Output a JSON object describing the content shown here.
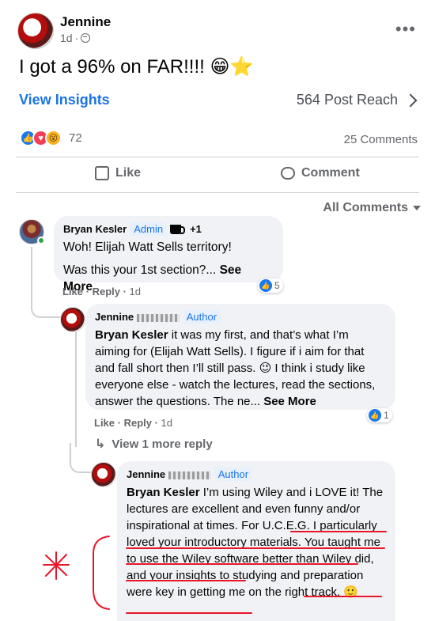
{
  "post": {
    "author": "Jennine",
    "time": "1d",
    "text": "I got a 96% on FAR!!!! 😁⭐",
    "insights_label": "View Insights",
    "reach_label": "564 Post Reach",
    "reaction_count": "72",
    "comments_count": "25 Comments",
    "like_label": "Like",
    "comment_label": "Comment",
    "all_comments_label": "All Comments"
  },
  "comments": [
    {
      "author": "Bryan Kesler",
      "badge": "Admin",
      "extra": "+1",
      "line1": "Woh! Elijah Watt Sells territory!",
      "line2": "Was this your 1st section?...",
      "see_more": "See More",
      "like": "Like",
      "reply": "Reply",
      "time": "1d",
      "reactions": "5"
    },
    {
      "author": "Jennine",
      "badge": "Author",
      "mention": "Bryan Kesler",
      "text": " it was my first, and that’s what I’m aiming for (Elijah Watt Sells). I figure if i aim for that and fall short then I’ll still pass. 😉 I think i study like everyone else - watch the lectures, read the sections, answer the questions. The ne...",
      "see_more": "See More",
      "like": "Like",
      "reply": "Reply",
      "time": "1d",
      "reactions": "1"
    },
    {
      "author": "Jennine",
      "badge": "Author",
      "mention": "Bryan Kesler",
      "text": " I’m using Wiley and i LOVE it! The lectures are excellent and even funny and/or inspirational at times. For U.C.E.G. I particularly loved your introductory materials. You taught me to use the Wiley software better than Wiley did, and your insights to studying and preparation were key in getting me on the right track. 🙂"
    }
  ],
  "view_more_reply": "View 1 more reply",
  "colors": {
    "accent": "#1b74e4",
    "annotation": "#e8162a"
  }
}
